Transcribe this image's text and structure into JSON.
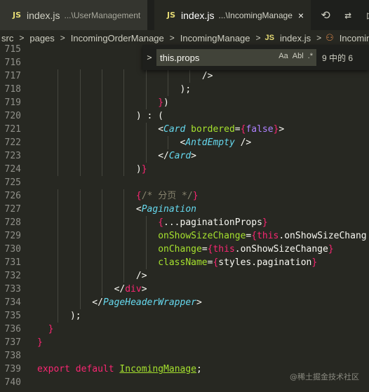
{
  "tabs": [
    {
      "icon": "JS",
      "name": "index.js",
      "path": "...\\UserManagement",
      "active": false
    },
    {
      "icon": "JS",
      "name": "index.js",
      "path": "...\\IncomingManage",
      "active": true,
      "close": "×"
    }
  ],
  "tab_actions": [
    {
      "name": "history-icon",
      "glyph": "⟲"
    },
    {
      "name": "source-control-icon",
      "glyph": "⇄"
    },
    {
      "name": "run-icon",
      "glyph": "▷"
    }
  ],
  "breadcrumb": {
    "items": [
      "src",
      "pages",
      "IncomingOrderManage",
      "IncomingManage"
    ],
    "file_icon": "JS",
    "file": "index.js",
    "symbol": "IncomingMana"
  },
  "find": {
    "query": "this.props",
    "match_case": "Aa",
    "whole_word": "Abl",
    "regex": ".*",
    "count": "9 中的 6",
    "toggle": ">"
  },
  "editor": {
    "lines": [
      {
        "n": "715",
        "code": ""
      },
      {
        "n": "716",
        "code": ""
      },
      {
        "n": "717",
        "code": "                              />"
      },
      {
        "n": "718",
        "code": "                          );"
      },
      {
        "n": "719",
        "code": "                      })"
      },
      {
        "n": "720",
        "code": "                  ) : ("
      },
      {
        "n": "721",
        "code": "                      <Card bordered={false}>"
      },
      {
        "n": "722",
        "code": "                          <AntdEmpty />"
      },
      {
        "n": "723",
        "code": "                      </Card>"
      },
      {
        "n": "724",
        "code": "                  )}"
      },
      {
        "n": "725",
        "code": ""
      },
      {
        "n": "726",
        "code": "                  {/* 分页 */}"
      },
      {
        "n": "727",
        "code": "                  <Pagination"
      },
      {
        "n": "728",
        "code": "                      {...paginationProps}"
      },
      {
        "n": "729",
        "code": "                      onShowSizeChange={this.onShowSizeChang"
      },
      {
        "n": "730",
        "code": "                      onChange={this.onShowSizeChange}"
      },
      {
        "n": "731",
        "code": "                      className={styles.pagination}"
      },
      {
        "n": "732",
        "code": "                  />"
      },
      {
        "n": "733",
        "code": "              </div>"
      },
      {
        "n": "734",
        "code": "          </PageHeaderWrapper>"
      },
      {
        "n": "735",
        "code": "      );"
      },
      {
        "n": "736",
        "code": "  }"
      },
      {
        "n": "737",
        "code": "}"
      },
      {
        "n": "738",
        "code": ""
      },
      {
        "n": "739",
        "code": "export default IncomingManage;"
      },
      {
        "n": "740",
        "code": ""
      }
    ]
  },
  "watermark": "@稀土掘金技术社区",
  "colors": {
    "background": "#272822",
    "tag": "#f92672",
    "component": "#66d9ef",
    "attribute": "#a6e22e",
    "boolean": "#ae81ff",
    "comment": "#88846f"
  }
}
